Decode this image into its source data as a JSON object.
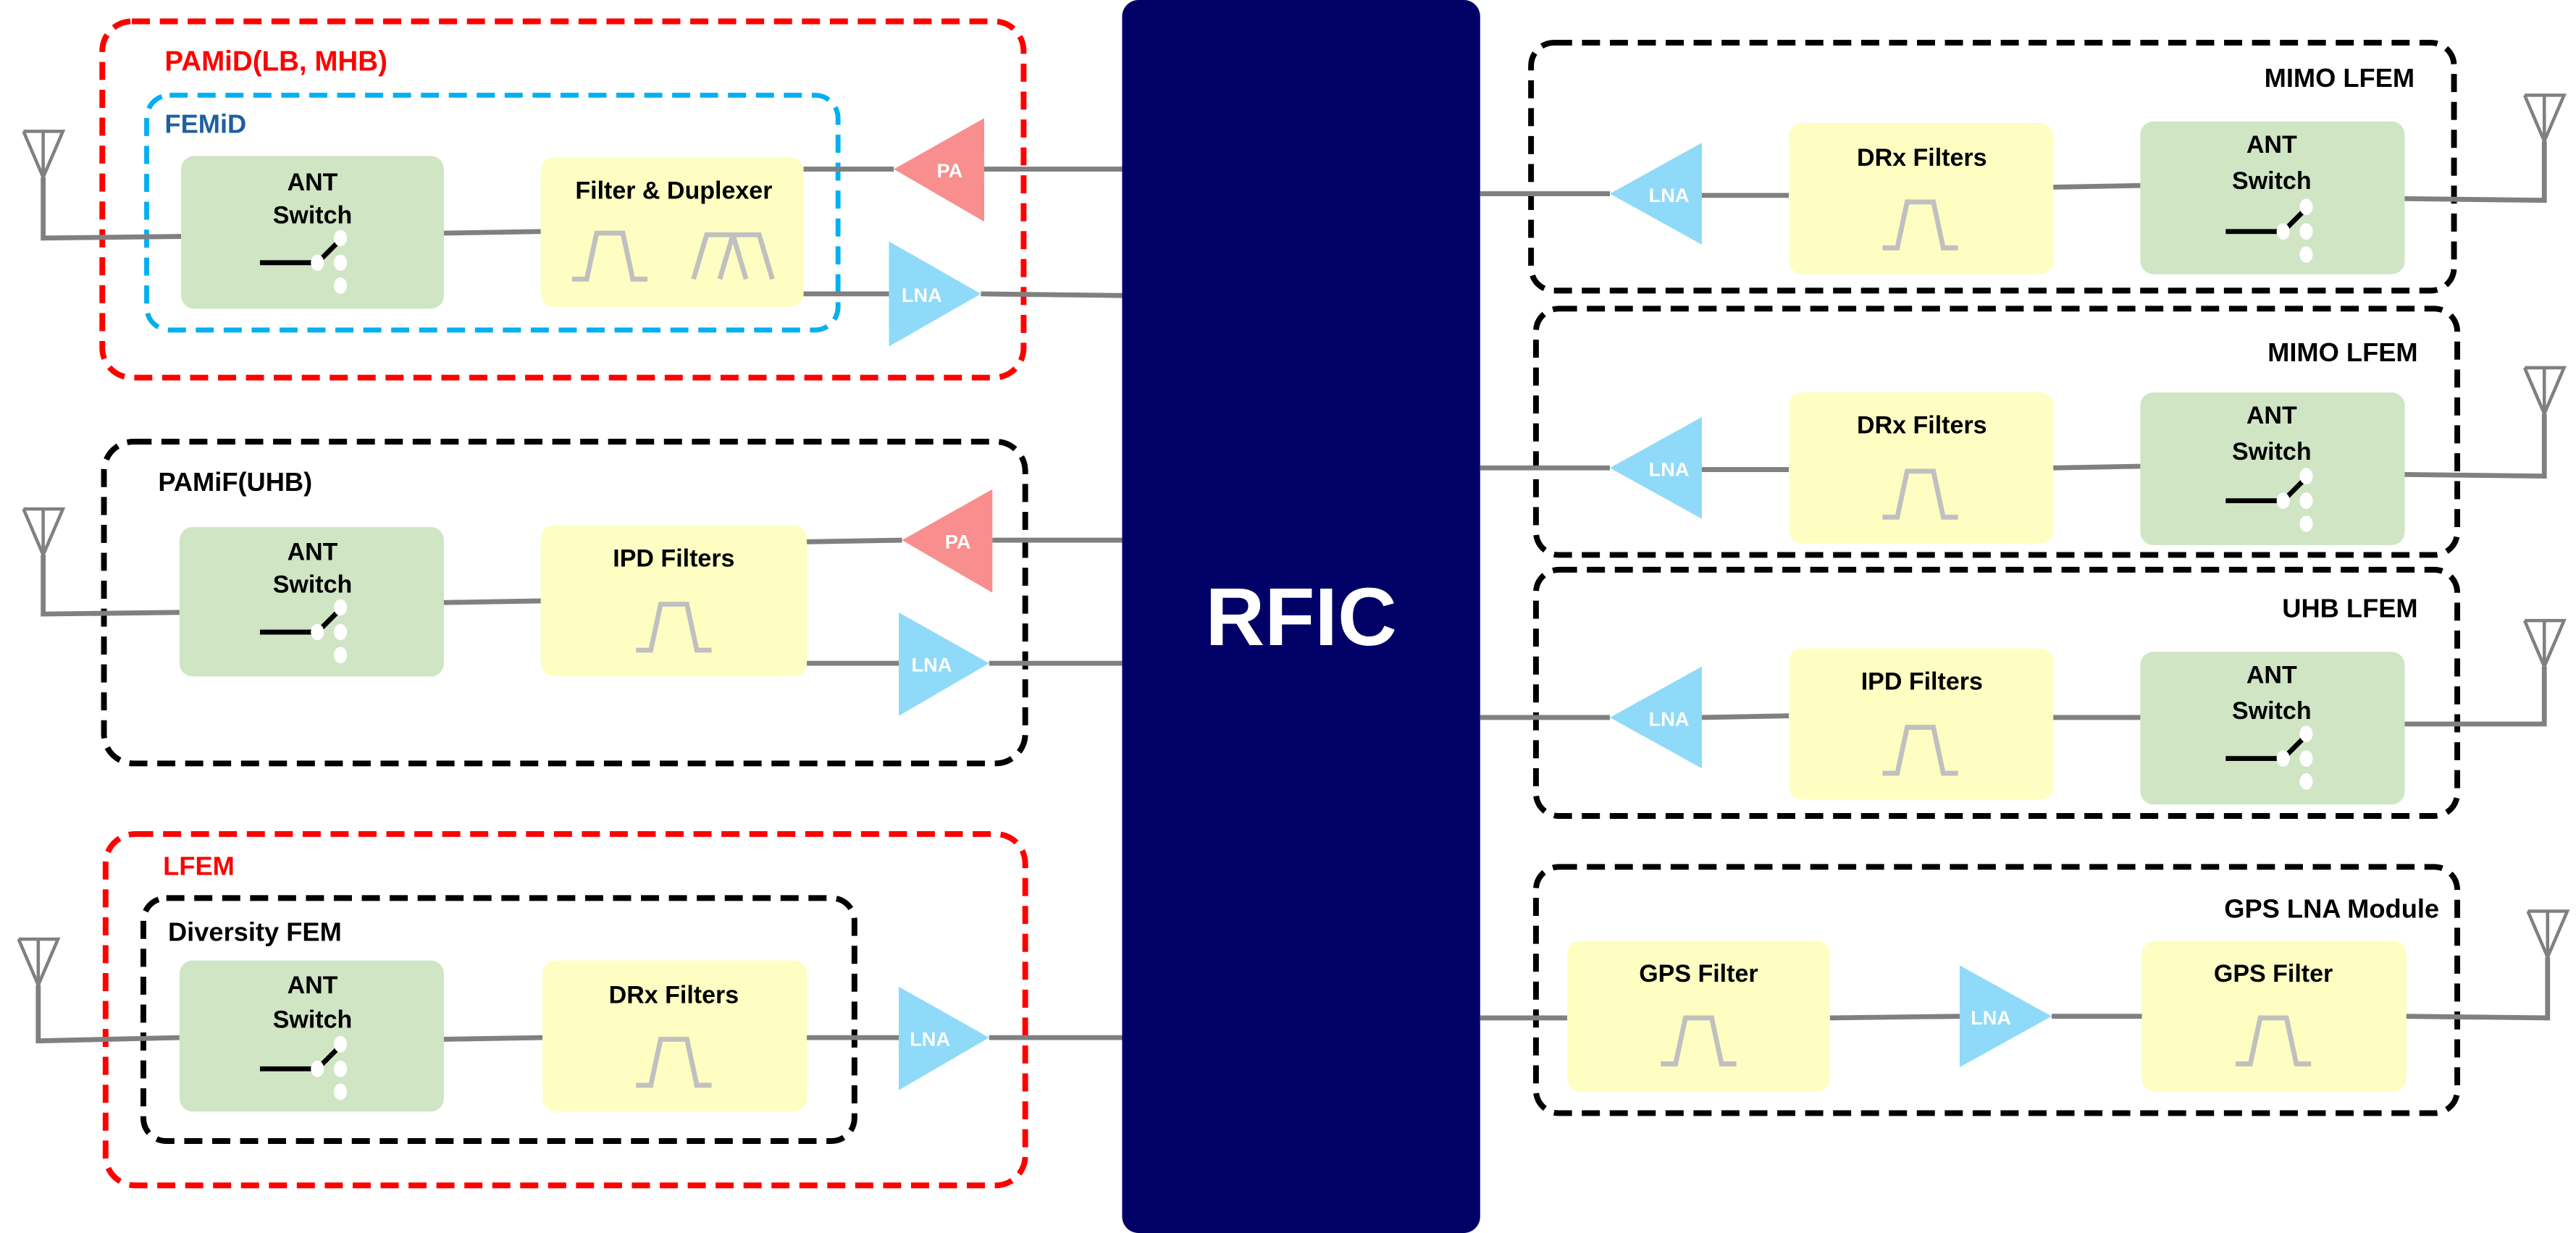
{
  "colors": {
    "rfic": "#000066",
    "pa": "#f98e8e",
    "lna": "#8fdaf8",
    "switch_block": "#cfe5c4",
    "filter_block": "#fefec2",
    "border_red": "#ff0000",
    "border_blue": "#00b0f0",
    "border_black": "#000000",
    "wire": "#808080"
  },
  "rfic": {
    "label": "RFIC"
  },
  "left_modules": [
    {
      "title": "PAMiD(LB, MHB)",
      "inner_title": "FEMiD",
      "switch_label": [
        "ANT",
        "Switch"
      ],
      "filter_label": "Filter & Duplexer",
      "amplifiers": [
        "PA",
        "LNA"
      ]
    },
    {
      "title": "PAMiF(UHB)",
      "switch_label": [
        "ANT",
        "Switch"
      ],
      "filter_label": "IPD Filters",
      "amplifiers": [
        "PA",
        "LNA"
      ]
    },
    {
      "title": "LFEM",
      "inner_title": "Diversity FEM",
      "switch_label": [
        "ANT",
        "Switch"
      ],
      "filter_label": "DRx Filters",
      "amplifiers": [
        "LNA"
      ]
    }
  ],
  "right_modules": [
    {
      "title": "MIMO LFEM",
      "amplifier": "LNA",
      "filter_label": "DRx Filters",
      "switch_label": [
        "ANT",
        "Switch"
      ]
    },
    {
      "title": "MIMO LFEM",
      "amplifier": "LNA",
      "filter_label": "DRx Filters",
      "switch_label": [
        "ANT",
        "Switch"
      ]
    },
    {
      "title": "UHB LFEM",
      "amplifier": "LNA",
      "filter_label": "IPD Filters",
      "switch_label": [
        "ANT",
        "Switch"
      ]
    },
    {
      "title": "GPS LNA Module",
      "filter1_label": "GPS Filter",
      "amplifier": "LNA",
      "filter2_label": "GPS Filter"
    }
  ]
}
